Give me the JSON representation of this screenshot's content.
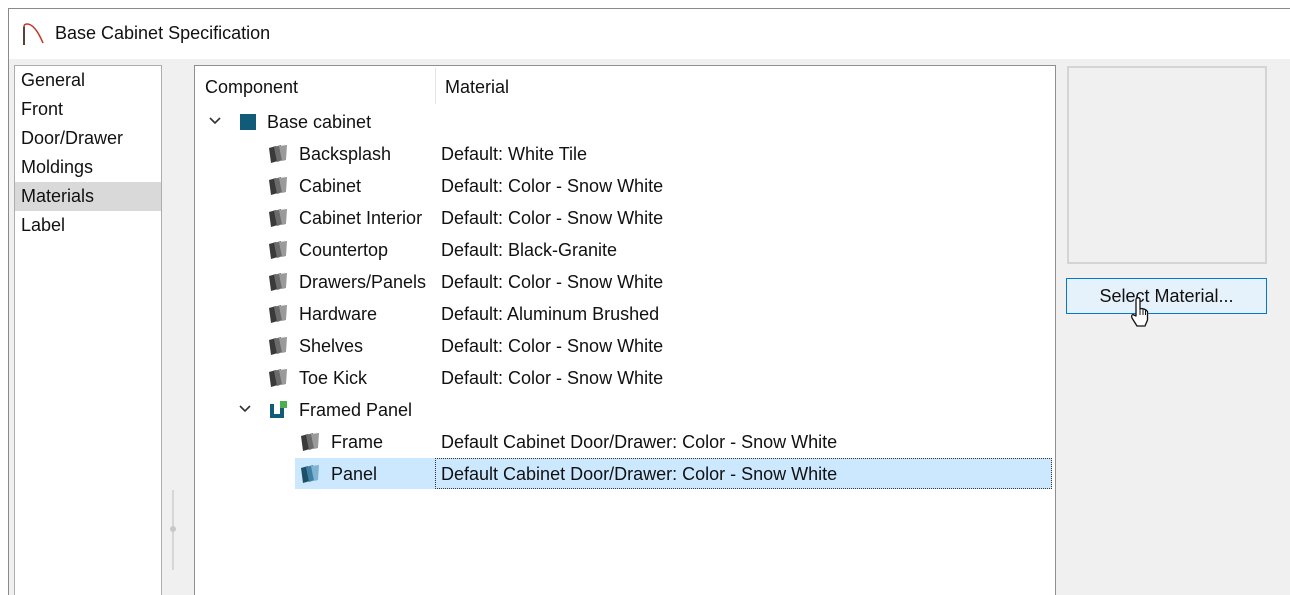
{
  "window": {
    "title": "Base Cabinet Specification"
  },
  "sidebar": {
    "items": [
      {
        "label": "General",
        "selected": false
      },
      {
        "label": "Front",
        "selected": false
      },
      {
        "label": "Door/Drawer",
        "selected": false
      },
      {
        "label": "Moldings",
        "selected": false
      },
      {
        "label": "Materials",
        "selected": true
      },
      {
        "label": "Label",
        "selected": false
      }
    ]
  },
  "tree": {
    "columns": {
      "component": "Component",
      "material": "Material"
    },
    "rows": [
      {
        "label": "Base cabinet",
        "material": "",
        "level": 0,
        "expander": "expanded",
        "icon": "base-cabinet-icon"
      },
      {
        "label": "Backsplash",
        "material": "Default: White Tile",
        "level": 1,
        "icon": "material-swatch-icon"
      },
      {
        "label": "Cabinet",
        "material": "Default: Color - Snow White",
        "level": 1,
        "icon": "material-swatch-icon"
      },
      {
        "label": "Cabinet Interior",
        "material": "Default: Color - Snow White",
        "level": 1,
        "icon": "material-swatch-icon"
      },
      {
        "label": "Countertop",
        "material": "Default: Black-Granite",
        "level": 1,
        "icon": "material-swatch-icon"
      },
      {
        "label": "Drawers/Panels",
        "material": "Default: Color - Snow White",
        "level": 1,
        "icon": "material-swatch-icon"
      },
      {
        "label": "Hardware",
        "material": "Default: Aluminum Brushed",
        "level": 1,
        "icon": "material-swatch-icon"
      },
      {
        "label": "Shelves",
        "material": "Default: Color - Snow White",
        "level": 1,
        "icon": "material-swatch-icon"
      },
      {
        "label": "Toe Kick",
        "material": "Default: Color - Snow White",
        "level": 1,
        "icon": "material-swatch-icon"
      },
      {
        "label": "Framed Panel",
        "material": "",
        "level": 1,
        "expander": "expanded",
        "icon": "framed-panel-icon"
      },
      {
        "label": "Frame",
        "material": "Default Cabinet Door/Drawer: Color - Snow White",
        "level": 2,
        "icon": "material-swatch-icon"
      },
      {
        "label": "Panel",
        "material": "Default Cabinet Door/Drawer: Color - Snow White",
        "level": 2,
        "icon": "material-swatch-icon",
        "selected": true
      }
    ]
  },
  "preview": {
    "label": ""
  },
  "buttons": {
    "select_material": "Select Material..."
  },
  "colors": {
    "selection": "#cce8ff",
    "accent": "#0078d7",
    "icon_teal": "#0f5b78",
    "icon_green": "#4caf50"
  }
}
